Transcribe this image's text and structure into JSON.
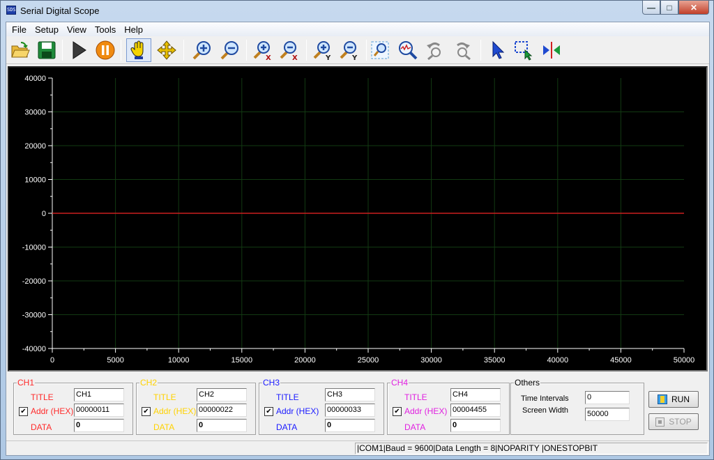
{
  "window": {
    "title": "Serial Digital Scope",
    "icon_text": "SDS"
  },
  "menu": [
    "File",
    "Setup",
    "View",
    "Tools",
    "Help"
  ],
  "toolbar": [
    {
      "icon": "open-folder-icon"
    },
    {
      "icon": "save-icon"
    },
    {
      "icon": "play-icon"
    },
    {
      "icon": "pause-icon"
    },
    {
      "icon": "hand-pan-icon",
      "active": true
    },
    {
      "icon": "move-arrows-icon"
    },
    {
      "icon": "zoom-in-icon"
    },
    {
      "icon": "zoom-out-icon"
    },
    {
      "icon": "zoom-in-x-icon"
    },
    {
      "icon": "zoom-out-x-icon"
    },
    {
      "icon": "zoom-in-y-icon"
    },
    {
      "icon": "zoom-out-y-icon"
    },
    {
      "icon": "zoom-window-icon"
    },
    {
      "icon": "zoom-fit-icon"
    },
    {
      "icon": "undo-zoom-icon"
    },
    {
      "icon": "redo-zoom-icon"
    },
    {
      "icon": "select-arrow-icon"
    },
    {
      "icon": "select-region-icon"
    },
    {
      "icon": "cursor-measure-icon"
    }
  ],
  "chart_data": {
    "type": "line",
    "title": "",
    "xlabel": "",
    "ylabel": "",
    "xlim": [
      0,
      50000
    ],
    "ylim": [
      -40000,
      40000
    ],
    "xticks": [
      "0",
      "5000",
      "10000",
      "15000",
      "20000",
      "25000",
      "30000",
      "35000",
      "40000",
      "45000",
      "50000"
    ],
    "yticks": [
      "40000",
      "30000",
      "20000",
      "10000",
      "0",
      "-10000",
      "-20000",
      "-30000",
      "-40000"
    ],
    "grid": true,
    "series": [
      {
        "color": "#cc1f1f",
        "x": [
          0,
          50000
        ],
        "y": [
          0,
          0
        ]
      }
    ]
  },
  "channels": [
    {
      "name": "CH1",
      "color": "#ff2a2a",
      "title_label": "TITLE",
      "addr_label": "Addr (HEX)",
      "data_label": "DATA",
      "title": "CH1",
      "addr": "00000011",
      "data": "0",
      "checked": "✔"
    },
    {
      "name": "CH2",
      "color": "#ffd200",
      "title_label": "TITLE",
      "addr_label": "Addr (HEX)",
      "data_label": "DATA",
      "title": "CH2",
      "addr": "00000022",
      "data": "0",
      "checked": "✔"
    },
    {
      "name": "CH3",
      "color": "#1a1aff",
      "title_label": "TITLE",
      "addr_label": "Addr (HEX)",
      "data_label": "DATA",
      "title": "CH3",
      "addr": "00000033",
      "data": "0",
      "checked": "✔"
    },
    {
      "name": "CH4",
      "color": "#e020e0",
      "title_label": "TITLE",
      "addr_label": "Addr (HEX)",
      "data_label": "DATA",
      "title": "CH4",
      "addr": "00004455",
      "data": "0",
      "checked": "✔"
    }
  ],
  "others": {
    "title": "Others",
    "time_intervals_label": "Time Intervals",
    "time_intervals": "0",
    "screen_width_label": "Screen Width",
    "screen_width": "50000"
  },
  "buttons": {
    "run": "RUN",
    "stop": "STOP"
  },
  "status": "|COM1|Baud = 9600|Data Length = 8|NOPARITY  |ONESTOPBIT"
}
